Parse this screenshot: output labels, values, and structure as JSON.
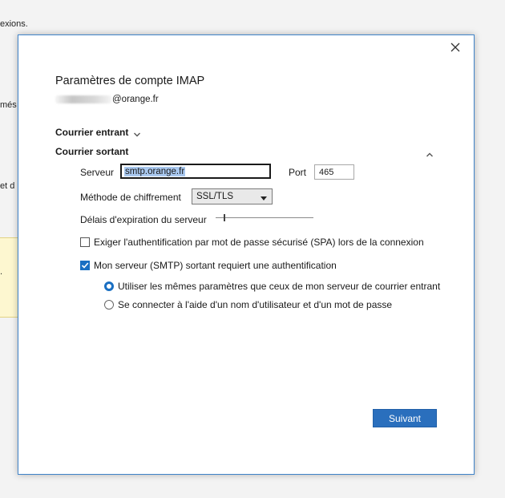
{
  "background": {
    "fragments": [
      "exions.",
      "més",
      "et d",
      "."
    ],
    "note_color": "#fdf7d0"
  },
  "dialog": {
    "title": "Paramètres de compte IMAP",
    "email_domain": "@orange.fr",
    "border_color": "#3f83c9",
    "close_icon": "close-icon"
  },
  "incoming": {
    "label": "Courrier entrant",
    "icon": "chevron-down-icon"
  },
  "outgoing": {
    "label": "Courrier sortant",
    "icon": "chevron-up-icon",
    "server_label": "Serveur",
    "server_value": "smtp.orange.fr",
    "port_label": "Port",
    "port_value": "465",
    "encryption_label": "Méthode de chiffrement",
    "encryption_value": "SSL/TLS",
    "timeout_label": "Délais d'expiration du serveur",
    "timeout_level": 0.08
  },
  "options": {
    "spa_label": "Exiger l'authentification par mot de passe sécurisé (SPA) lors de la connexion",
    "spa_checked": false,
    "smtp_auth_label": "Mon serveur (SMTP) sortant requiert une authentification",
    "smtp_auth_checked": true,
    "radio_same_label": "Utiliser les mêmes paramètres que ceux de mon serveur de courrier entrant",
    "radio_same_checked": true,
    "radio_login_label": "Se connecter à l'aide d'un nom d'utilisateur et d'un mot de passe",
    "radio_login_checked": false
  },
  "footer": {
    "next_label": "Suivant"
  },
  "colors": {
    "accent": "#1a6fc2",
    "button": "#2a6fbd"
  }
}
